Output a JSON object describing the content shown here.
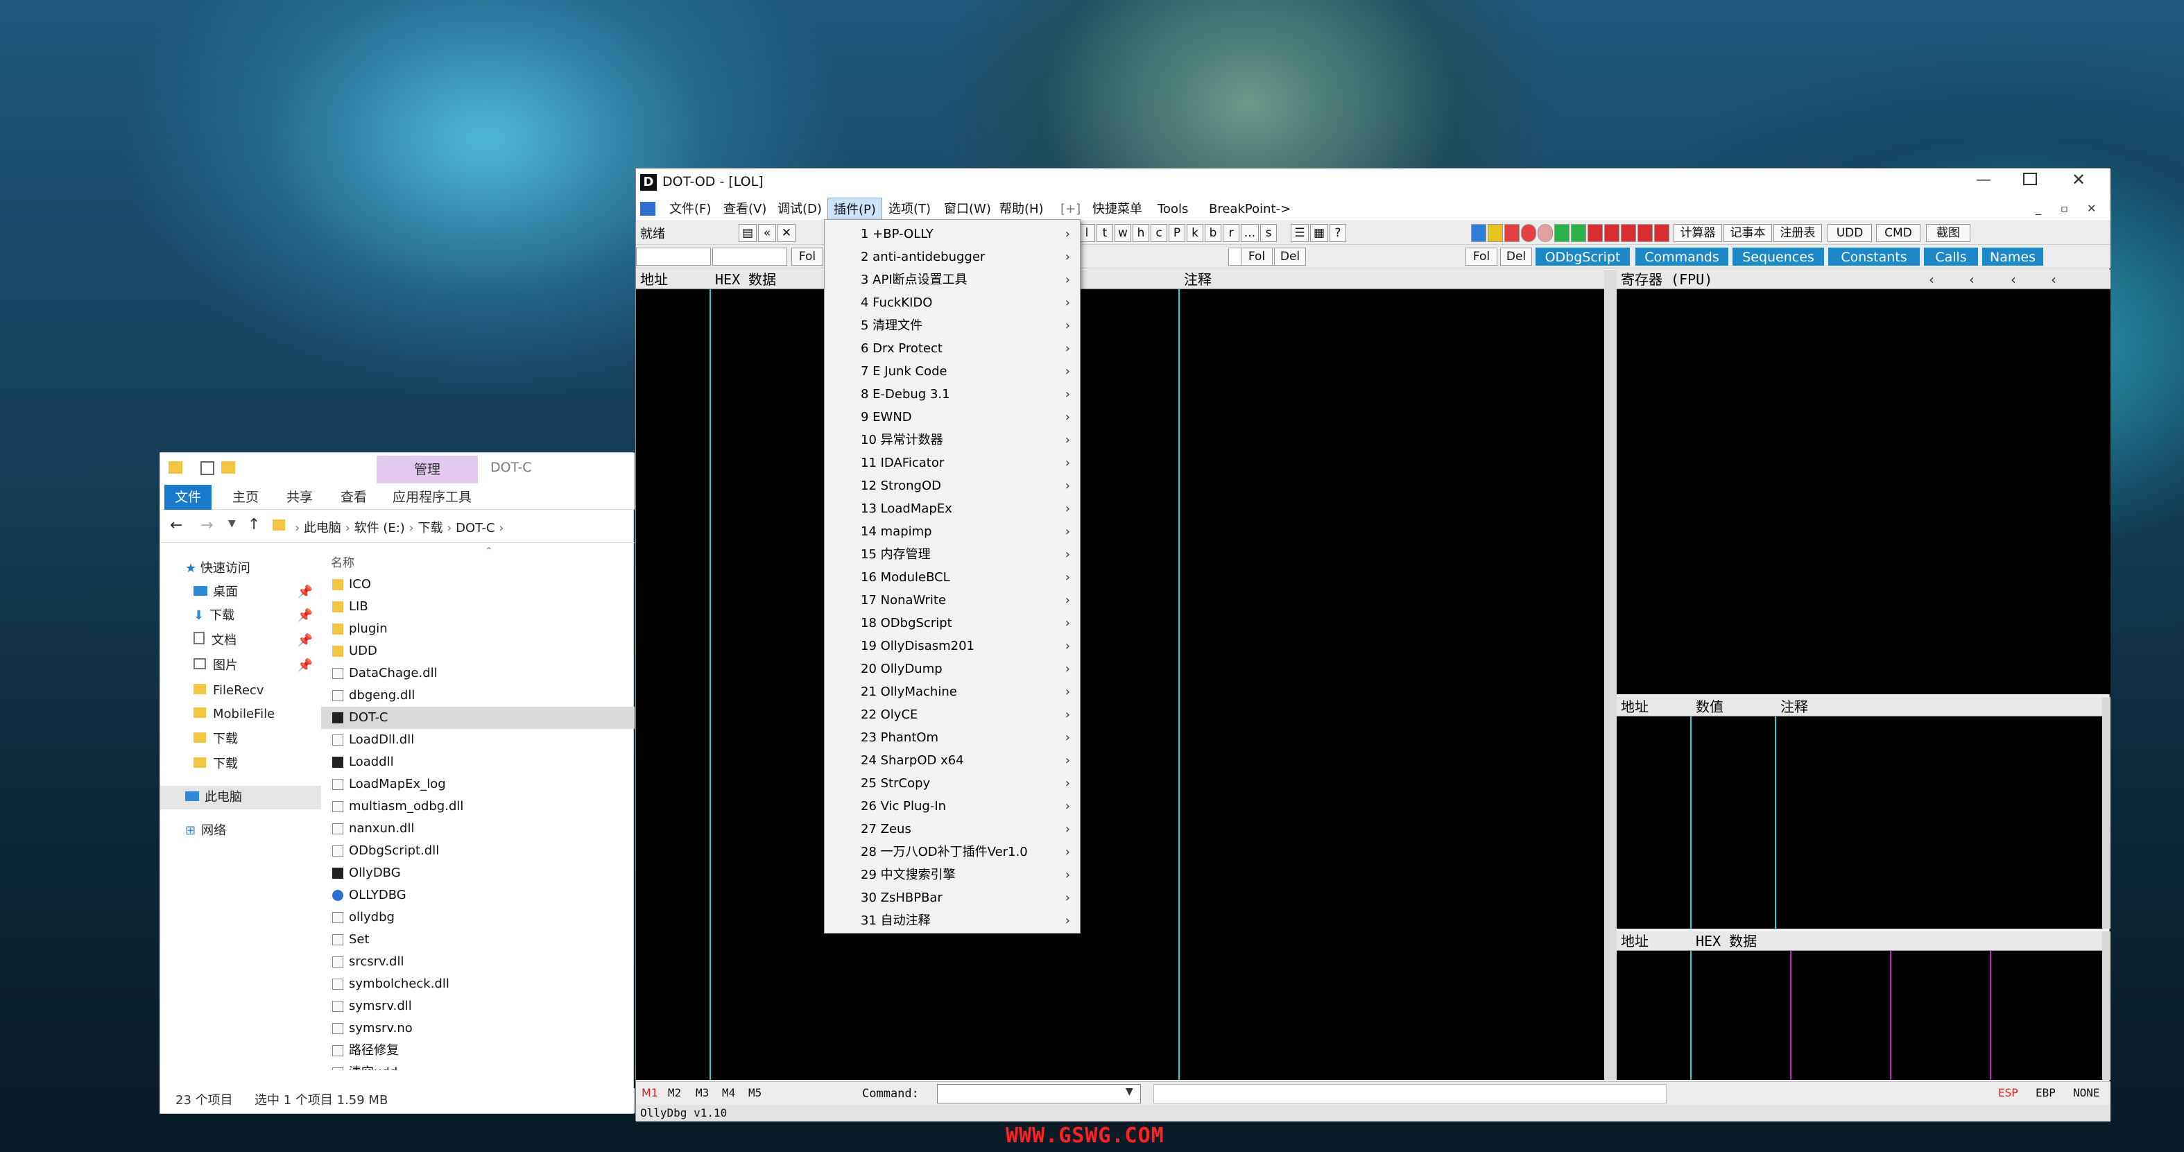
{
  "explorer": {
    "ribbon_manage": "管理",
    "title": "DOT-C",
    "tabs": [
      "文件",
      "主页",
      "共享",
      "查看",
      "应用程序工具"
    ],
    "breadcrumb": [
      "此电脑",
      "软件 (E:)",
      "下载",
      "DOT-C"
    ],
    "column_name": "名称",
    "nav": [
      "快速访问",
      "桌面",
      "下载",
      "文档",
      "图片",
      "FileRecv",
      "MobileFile",
      "下载",
      "下载",
      "此电脑",
      "网络"
    ],
    "files": [
      "ICO",
      "LIB",
      "plugin",
      "UDD",
      "DataChage.dll",
      "dbgeng.dll",
      "DOT-C",
      "LoadDll.dll",
      "Loaddll",
      "LoadMapEx_log",
      "multiasm_odbg.dll",
      "nanxun.dll",
      "ODbgScript.dll",
      "OllyDBG",
      "OLLYDBG",
      "ollydbg",
      "Set",
      "srcsrv.dll",
      "symbolcheck.dll",
      "symsrv.dll",
      "symsrv.no",
      "路径修复",
      "清空udd"
    ],
    "status_count": "23 个项目",
    "status_selected": "选中 1 个项目  1.59 MB"
  },
  "olly": {
    "title": "DOT-OD - [LOL]",
    "menu": [
      "文件(F)",
      "查看(V)",
      "调试(D)",
      "插件(P)",
      "选项(T)",
      "窗口(W)",
      "帮助(H)",
      "[+]",
      "快捷菜单",
      "Tools",
      "BreakPoint->"
    ],
    "status_ready": "就绪",
    "letters": [
      "l",
      "t",
      "w",
      "h",
      "c",
      "P",
      "k",
      "b",
      "r",
      "...",
      "s"
    ],
    "tool_cn": [
      "计算器",
      "记事本",
      "注册表",
      "UDD",
      "CMD",
      "截图"
    ],
    "fol": "Fol",
    "del": "Del",
    "plugin_tabs": [
      "ODbgScript",
      "Commands",
      "Sequences",
      "Constants",
      "Calls",
      "Names"
    ],
    "cpu_headers": {
      "addr": "地址",
      "hex": "HEX 数据",
      "comment": "注释"
    },
    "reg_header": "寄存器 (FPU)",
    "stack_headers": {
      "addr": "地址",
      "value": "数值",
      "comment": "注释"
    },
    "dump_headers": {
      "addr": "地址",
      "hex": "HEX 数据"
    },
    "bottom_tabs": [
      "M1",
      "M2",
      "M3",
      "M4",
      "M5"
    ],
    "command_label": "Command:",
    "regs": [
      "ESP",
      "EBP",
      "NONE"
    ],
    "status_version": "OllyDbg v1.10"
  },
  "plugin_menu": [
    "1 +BP-OLLY",
    "2 anti-antidebugger",
    "3 API断点设置工具",
    "4 FuckKIDO",
    "5 清理文件",
    "6 Drx Protect",
    "7 E Junk Code",
    "8 E-Debug 3.1",
    "9 EWND",
    "10 异常计数器",
    "11 IDAFicator",
    "12 StrongOD",
    "13 LoadMapEx",
    "14 mapimp",
    "15 内存管理",
    "16 ModuleBCL",
    "17 NonaWrite",
    "18 ODbgScript",
    "19 OllyDisasm201",
    "20 OllyDump",
    "21 OllyMachine",
    "22 OlyCE",
    "23 PhantOm",
    "24 SharpOD x64",
    "25 StrCopy",
    "26 Vic Plug-In",
    "27 Zeus",
    "28 一万八OD补丁插件Ver1.0",
    "29 中文搜索引擎",
    "30 ZsHBPBar",
    "31 自动注释"
  ],
  "watermark": "WWW.GSWG.COM"
}
